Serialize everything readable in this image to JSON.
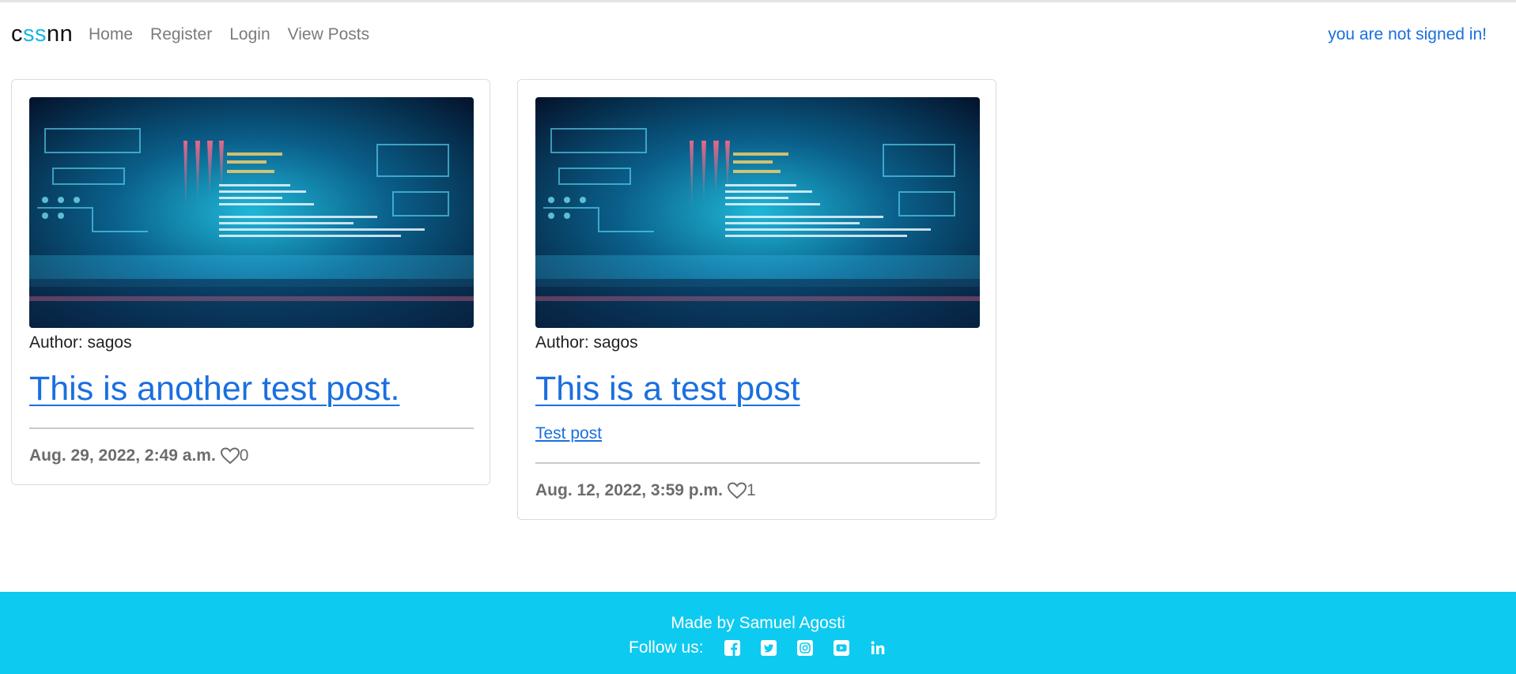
{
  "navbar": {
    "brand_prefix": "c",
    "brand_accent": "ss",
    "brand_suffix": "nn",
    "links": [
      {
        "label": "Home"
      },
      {
        "label": "Register"
      },
      {
        "label": "Login"
      },
      {
        "label": "View Posts"
      }
    ],
    "status": "you are not signed in!"
  },
  "posts": [
    {
      "author": "Author: sagos",
      "title": "This is another test post.",
      "snippet": "",
      "date": "Aug. 29, 2022, 2:49 a.m.",
      "likes": "0",
      "image_icon": "code-screen-image"
    },
    {
      "author": "Author: sagos",
      "title": "This is a test post",
      "snippet": "Test post",
      "date": "Aug. 12, 2022, 3:59 p.m.",
      "likes": "1",
      "image_icon": "code-screen-image"
    }
  ],
  "footer": {
    "credit": "Made by Samuel Agosti",
    "follow_label": "Follow us:",
    "socials": [
      "facebook-icon",
      "twitter-icon",
      "instagram-icon",
      "youtube-icon",
      "linkedin-icon"
    ]
  },
  "colors": {
    "accent": "#18b6e8",
    "link": "#1a6fe0",
    "footer_bg": "#0dcaf0",
    "muted": "#6c6c6c"
  }
}
